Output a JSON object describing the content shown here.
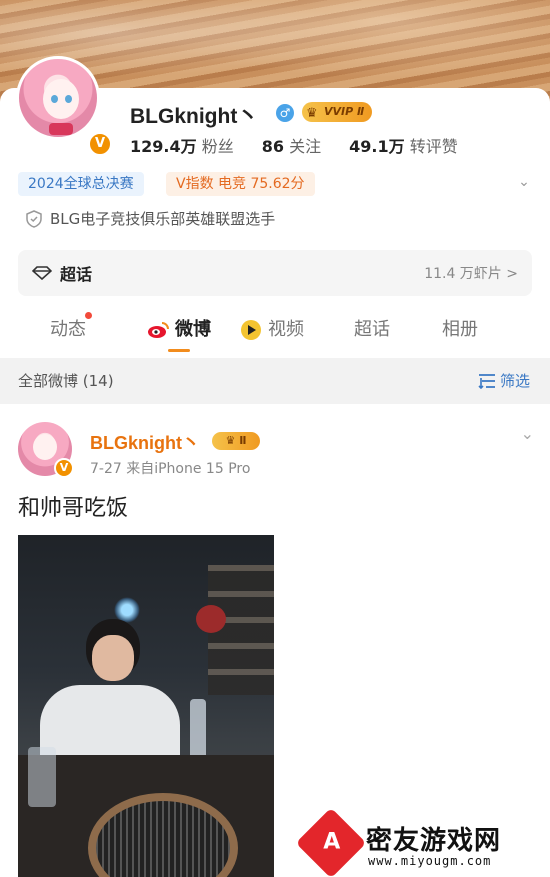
{
  "profile": {
    "name": "BLGknight丶",
    "vvip_label": "VVIP Ⅱ",
    "stats": [
      {
        "value": "129.4万",
        "label": "粉丝"
      },
      {
        "value": "86",
        "label": "关注"
      },
      {
        "value": "49.1万",
        "label": "转评赞"
      }
    ],
    "tags": [
      "2024全球总决赛",
      "V指数 电竞 75.62分"
    ],
    "bio": "BLG电子竞技俱乐部英雄联盟选手"
  },
  "chaohua": {
    "label": "超话",
    "count": "11.4 万虾片 >"
  },
  "tabs": [
    {
      "label": "动态",
      "active": false,
      "icon": "none"
    },
    {
      "label": "微博",
      "active": true,
      "icon": "weibo-icon"
    },
    {
      "label": "视频",
      "active": false,
      "icon": "video-icon"
    },
    {
      "label": "超话",
      "active": false,
      "icon": "none"
    },
    {
      "label": "相册",
      "active": false,
      "icon": "none"
    }
  ],
  "filterbar": {
    "all_label": "全部微博 (14)",
    "filter_label": "筛选"
  },
  "post": {
    "author": "BLGknight丶",
    "level_label": "Ⅱ",
    "meta": "7-27  来自iPhone 15 Pro",
    "text": "和帅哥吃饭"
  },
  "watermark": {
    "title": "密友游戏网",
    "url": "www.miyougm.com"
  },
  "colors": {
    "accent_orange": "#f28c1d",
    "link_blue": "#3a78c4",
    "vip_gold": "#f5c24a",
    "brand_red": "#e3262b"
  }
}
